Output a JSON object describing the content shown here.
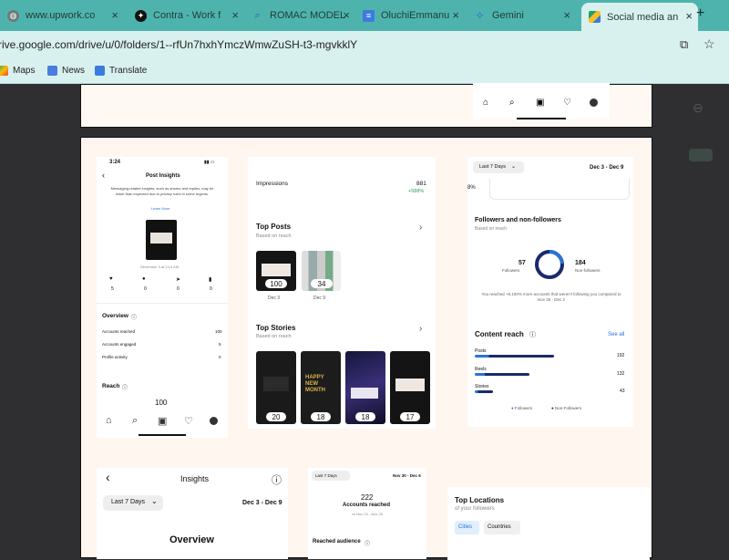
{
  "browser": {
    "tabs": [
      {
        "label": "www.upwork.co",
        "icon": "globe-icon"
      },
      {
        "label": "Contra - Work f",
        "icon": "contra-icon"
      },
      {
        "label": "ROMAC MODEL",
        "icon": "search-icon"
      },
      {
        "label": "OluchiEmmanu",
        "icon": "docs-icon"
      },
      {
        "label": "Gemini",
        "icon": "gemini-icon"
      },
      {
        "label": "Social media an",
        "icon": "drive-icon"
      }
    ],
    "new_tab": "+",
    "url": "rive.google.com/drive/u/0/folders/1--rfUn7hxhYmczWmwZuSH-t3-mgvkklY",
    "bookmarks": [
      "Maps",
      "News",
      "Translate"
    ]
  },
  "post_insights": {
    "time": "3:24",
    "title": "Post Insights",
    "note": "Messaging-related insights, such as shares and replies, may be lower than expected due to privacy rules in some regions.",
    "learn_more": "Learn More",
    "date_line": "December 3 at 2:14 AM",
    "stats": [
      "5",
      "0",
      "0",
      "0"
    ],
    "overview_title": "Overview",
    "rows": [
      {
        "label": "Accounts reached",
        "value": "100"
      },
      {
        "label": "Accounts engaged",
        "value": "5"
      },
      {
        "label": "Profile activity",
        "value": "0"
      }
    ],
    "reach_title": "Reach",
    "reach_value": "100"
  },
  "top_content": {
    "impressions_label": "Impressions",
    "impressions_value": "881",
    "impressions_change": "+588%",
    "top_posts_title": "Top Posts",
    "top_posts_sub": "Based on reach",
    "posts": [
      {
        "value": "100",
        "date": "Dec 3"
      },
      {
        "value": "34",
        "date": "Dec 9"
      }
    ],
    "top_stories_title": "Top Stories",
    "top_stories_sub": "Based on reach",
    "stories": [
      "20",
      "18",
      "18",
      "17"
    ],
    "story_caption": "HAPPY NEW MONTH"
  },
  "followers": {
    "range_btn": "Last 7 Days",
    "date_range": "Dec 3 - Dec 9",
    "partial_pct": "8%",
    "title": "Followers and non-followers",
    "sub": "Based on reach",
    "followers_value": "57",
    "followers_label": "Followers",
    "nonfollowers_value": "184",
    "nonfollowers_label": "Non-followers",
    "reach_note": "You reached +8,100% more accounts that weren't following you compared to Nov 26 - Dec 2",
    "content_reach_title": "Content reach",
    "see_all": "See all",
    "bars": [
      {
        "label": "Posts",
        "value": "192",
        "fraction": 1.0
      },
      {
        "label": "Reels",
        "value": "132",
        "fraction": 0.69
      },
      {
        "label": "Stories",
        "value": "43",
        "fraction": 0.23
      }
    ],
    "legend_followers": "Followers",
    "legend_nonfollowers": "Non-Followers",
    "colors": {
      "followers": "#2a73d9",
      "nonfollowers": "#1a2a6c"
    }
  },
  "insights_bottom": {
    "title": "Insights",
    "range_btn": "Last 7 Days",
    "date_range": "Dec 3 - Dec 9",
    "overview": "Overview"
  },
  "accounts_reached": {
    "range_btn": "Last 7 Days",
    "date_range": "Nov 30 - Dec 6",
    "value": "222",
    "label": "Accounts reached",
    "sub": "vs Nov 23 - Nov 29",
    "reached_audience": "Reached audience"
  },
  "locations": {
    "title": "Top Locations",
    "sub": "of your followers",
    "tab_cities": "Cities",
    "tab_countries": "Countries"
  }
}
